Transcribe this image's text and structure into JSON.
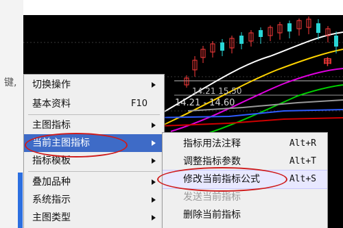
{
  "left_fragment": "键,",
  "chart": {
    "label_1": "14.21 15.50",
    "label_2": "14.21 - 14.60",
    "red_label": "申"
  },
  "context_menu": {
    "items": [
      {
        "label": "切换操作",
        "has_submenu": true,
        "shortcut": ""
      },
      {
        "label": "基本资料",
        "has_submenu": false,
        "shortcut": "F10"
      },
      {
        "label": "主图指标",
        "has_submenu": true,
        "shortcut": ""
      },
      {
        "label": "当前主图指标",
        "has_submenu": true,
        "shortcut": "",
        "active": true
      },
      {
        "label": "指标模板",
        "has_submenu": true,
        "shortcut": ""
      },
      {
        "label": "叠加品种",
        "has_submenu": true,
        "shortcut": ""
      },
      {
        "label": "系统指示",
        "has_submenu": true,
        "shortcut": ""
      },
      {
        "label": "主图类型",
        "has_submenu": true,
        "shortcut": ""
      }
    ]
  },
  "submenu": {
    "items": [
      {
        "label": "指标用法注释",
        "shortcut": "Alt+R"
      },
      {
        "label": "调整指标参数",
        "shortcut": "Alt+T"
      },
      {
        "label": "修改当前指标公式",
        "shortcut": "Alt+S",
        "highlight": true
      },
      {
        "label": "发送当前指标",
        "shortcut": "",
        "disabled": true
      },
      {
        "label": "删除当前指标",
        "shortcut": ""
      }
    ]
  },
  "colors": {
    "chart_bg": "#000000",
    "menu_bg": "#efefef",
    "active_bg": "#3e6bc7",
    "annotation": "#cf1b1b",
    "candle_up": "#ff3b3b",
    "candle_down": "#29d6d6"
  }
}
